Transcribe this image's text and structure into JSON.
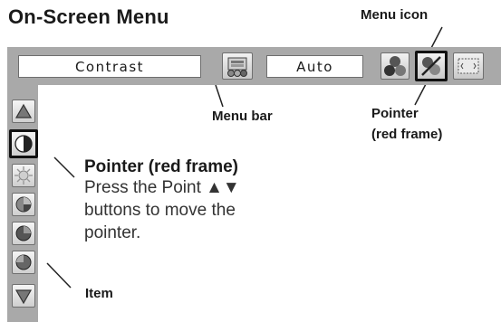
{
  "title": "On-Screen Menu",
  "menu_bar": {
    "selected_item_label": "Contrast",
    "value_field": "Auto",
    "icons": [
      "display-icon",
      "color-balls-icon",
      "pointer-icon",
      "screen-icon"
    ]
  },
  "items": [
    "triangle-up-icon",
    "half-circle-contrast-icon",
    "sun-brightness-icon",
    "color-pie-icon",
    "tint-sphere-icon",
    "triangle-down-icon"
  ],
  "callouts": {
    "menu_icon": "Menu icon",
    "menu_bar": "Menu bar",
    "pointer_line1": "Pointer",
    "pointer_line2": "(red frame)",
    "item": "Item"
  },
  "pointer_note": {
    "title": "Pointer (red frame)",
    "line1": "Press the Point ▲▼",
    "line2": "buttons to move the",
    "line3": "pointer."
  }
}
